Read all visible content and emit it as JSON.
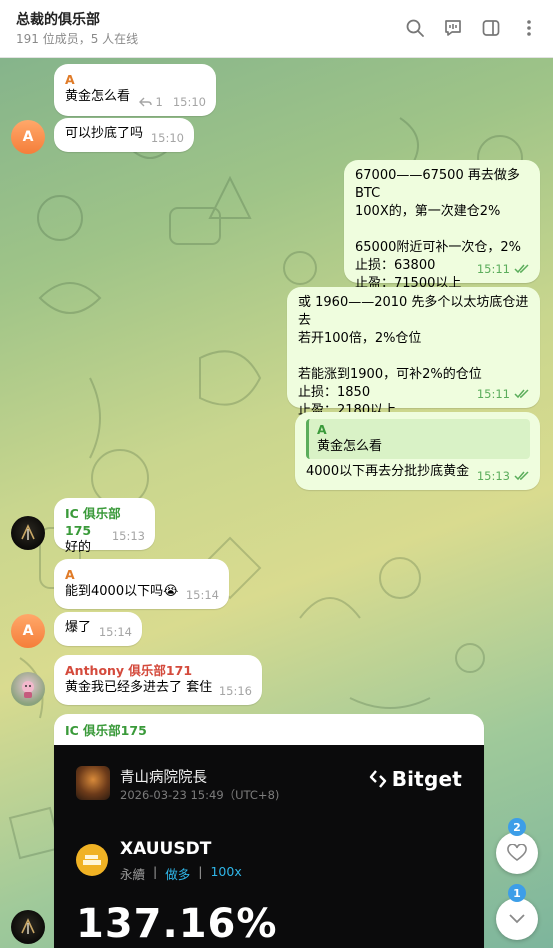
{
  "header": {
    "title": "总裁的俱乐部",
    "subtitle": "191 位成员，5 人在线",
    "icons": [
      "search-icon",
      "chat-icon",
      "sidebar-toggle-icon",
      "more-icon"
    ]
  },
  "messages": [
    {
      "sender": "A",
      "text": "黄金怎么看",
      "replies": "1",
      "time": "15:10"
    },
    {
      "avatar": "A",
      "text": "可以抄底了吗",
      "time": "15:10"
    },
    {
      "text": "67000——67500 再去做多BTC\n100X的，第一次建仓2%\n\n65000附近可补一次仓，2%\n止损：63800\n止盈：71500以上",
      "time": "15:11"
    },
    {
      "text": "或 1960——2010 先多个以太坊底仓进去\n若开100倍，2%仓位\n\n若能涨到1900，可补2%的仓位\n止损：1850\n止盈：2180以上",
      "time": "15:11"
    },
    {
      "quote_name": "A",
      "quote_text": "黄金怎么看",
      "text": "4000以下再去分批抄底黄金",
      "time": "15:13"
    },
    {
      "sender": "IC 俱乐部175",
      "text": "好的",
      "time": "15:13"
    },
    {
      "sender": "A",
      "text": "能到4000以下吗😭",
      "time": "15:14"
    },
    {
      "avatar": "A",
      "text": "爆了",
      "time": "15:14"
    },
    {
      "sender": "Anthony 俱乐部171",
      "text": "黄金我已经多进去了 套住",
      "time": "15:16"
    }
  ],
  "card": {
    "sender": "IC 俱乐部175",
    "user": "青山病院院長",
    "date": "2026-03-23 15:49（UTC+8)",
    "brand": "Bitget",
    "pair": "XAUUSDT",
    "kind": "永續",
    "side": "做多",
    "leverage": "100x",
    "pnl": "137.16%"
  },
  "fabs": {
    "reactions_badge": "2",
    "unread_badge": "1"
  },
  "colors": {
    "outgoing_bubble": "#effdde",
    "incoming_bubble": "#ffffff",
    "accent_green": "#5bad5b",
    "badge_blue": "#3d9ee8"
  }
}
